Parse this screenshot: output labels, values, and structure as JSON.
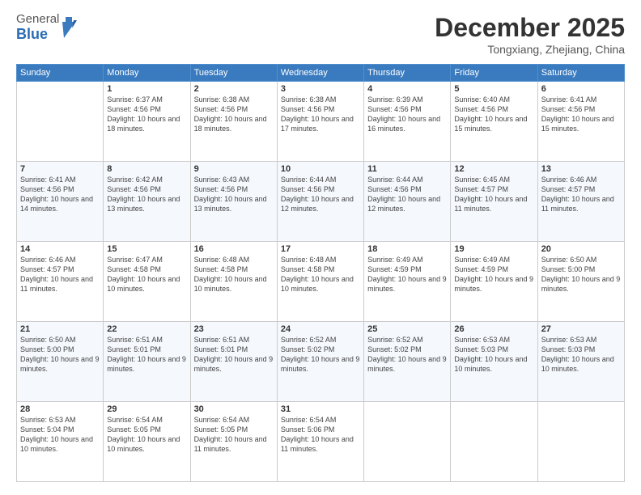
{
  "header": {
    "logo_general": "General",
    "logo_blue": "Blue",
    "month_year": "December 2025",
    "location": "Tongxiang, Zhejiang, China"
  },
  "weekdays": [
    "Sunday",
    "Monday",
    "Tuesday",
    "Wednesday",
    "Thursday",
    "Friday",
    "Saturday"
  ],
  "weeks": [
    [
      {
        "day": "",
        "sunrise": "",
        "sunset": "",
        "daylight": ""
      },
      {
        "day": "1",
        "sunrise": "Sunrise: 6:37 AM",
        "sunset": "Sunset: 4:56 PM",
        "daylight": "Daylight: 10 hours and 18 minutes."
      },
      {
        "day": "2",
        "sunrise": "Sunrise: 6:38 AM",
        "sunset": "Sunset: 4:56 PM",
        "daylight": "Daylight: 10 hours and 18 minutes."
      },
      {
        "day": "3",
        "sunrise": "Sunrise: 6:38 AM",
        "sunset": "Sunset: 4:56 PM",
        "daylight": "Daylight: 10 hours and 17 minutes."
      },
      {
        "day": "4",
        "sunrise": "Sunrise: 6:39 AM",
        "sunset": "Sunset: 4:56 PM",
        "daylight": "Daylight: 10 hours and 16 minutes."
      },
      {
        "day": "5",
        "sunrise": "Sunrise: 6:40 AM",
        "sunset": "Sunset: 4:56 PM",
        "daylight": "Daylight: 10 hours and 15 minutes."
      },
      {
        "day": "6",
        "sunrise": "Sunrise: 6:41 AM",
        "sunset": "Sunset: 4:56 PM",
        "daylight": "Daylight: 10 hours and 15 minutes."
      }
    ],
    [
      {
        "day": "7",
        "sunrise": "Sunrise: 6:41 AM",
        "sunset": "Sunset: 4:56 PM",
        "daylight": "Daylight: 10 hours and 14 minutes."
      },
      {
        "day": "8",
        "sunrise": "Sunrise: 6:42 AM",
        "sunset": "Sunset: 4:56 PM",
        "daylight": "Daylight: 10 hours and 13 minutes."
      },
      {
        "day": "9",
        "sunrise": "Sunrise: 6:43 AM",
        "sunset": "Sunset: 4:56 PM",
        "daylight": "Daylight: 10 hours and 13 minutes."
      },
      {
        "day": "10",
        "sunrise": "Sunrise: 6:44 AM",
        "sunset": "Sunset: 4:56 PM",
        "daylight": "Daylight: 10 hours and 12 minutes."
      },
      {
        "day": "11",
        "sunrise": "Sunrise: 6:44 AM",
        "sunset": "Sunset: 4:56 PM",
        "daylight": "Daylight: 10 hours and 12 minutes."
      },
      {
        "day": "12",
        "sunrise": "Sunrise: 6:45 AM",
        "sunset": "Sunset: 4:57 PM",
        "daylight": "Daylight: 10 hours and 11 minutes."
      },
      {
        "day": "13",
        "sunrise": "Sunrise: 6:46 AM",
        "sunset": "Sunset: 4:57 PM",
        "daylight": "Daylight: 10 hours and 11 minutes."
      }
    ],
    [
      {
        "day": "14",
        "sunrise": "Sunrise: 6:46 AM",
        "sunset": "Sunset: 4:57 PM",
        "daylight": "Daylight: 10 hours and 11 minutes."
      },
      {
        "day": "15",
        "sunrise": "Sunrise: 6:47 AM",
        "sunset": "Sunset: 4:58 PM",
        "daylight": "Daylight: 10 hours and 10 minutes."
      },
      {
        "day": "16",
        "sunrise": "Sunrise: 6:48 AM",
        "sunset": "Sunset: 4:58 PM",
        "daylight": "Daylight: 10 hours and 10 minutes."
      },
      {
        "day": "17",
        "sunrise": "Sunrise: 6:48 AM",
        "sunset": "Sunset: 4:58 PM",
        "daylight": "Daylight: 10 hours and 10 minutes."
      },
      {
        "day": "18",
        "sunrise": "Sunrise: 6:49 AM",
        "sunset": "Sunset: 4:59 PM",
        "daylight": "Daylight: 10 hours and 9 minutes."
      },
      {
        "day": "19",
        "sunrise": "Sunrise: 6:49 AM",
        "sunset": "Sunset: 4:59 PM",
        "daylight": "Daylight: 10 hours and 9 minutes."
      },
      {
        "day": "20",
        "sunrise": "Sunrise: 6:50 AM",
        "sunset": "Sunset: 5:00 PM",
        "daylight": "Daylight: 10 hours and 9 minutes."
      }
    ],
    [
      {
        "day": "21",
        "sunrise": "Sunrise: 6:50 AM",
        "sunset": "Sunset: 5:00 PM",
        "daylight": "Daylight: 10 hours and 9 minutes."
      },
      {
        "day": "22",
        "sunrise": "Sunrise: 6:51 AM",
        "sunset": "Sunset: 5:01 PM",
        "daylight": "Daylight: 10 hours and 9 minutes."
      },
      {
        "day": "23",
        "sunrise": "Sunrise: 6:51 AM",
        "sunset": "Sunset: 5:01 PM",
        "daylight": "Daylight: 10 hours and 9 minutes."
      },
      {
        "day": "24",
        "sunrise": "Sunrise: 6:52 AM",
        "sunset": "Sunset: 5:02 PM",
        "daylight": "Daylight: 10 hours and 9 minutes."
      },
      {
        "day": "25",
        "sunrise": "Sunrise: 6:52 AM",
        "sunset": "Sunset: 5:02 PM",
        "daylight": "Daylight: 10 hours and 9 minutes."
      },
      {
        "day": "26",
        "sunrise": "Sunrise: 6:53 AM",
        "sunset": "Sunset: 5:03 PM",
        "daylight": "Daylight: 10 hours and 10 minutes."
      },
      {
        "day": "27",
        "sunrise": "Sunrise: 6:53 AM",
        "sunset": "Sunset: 5:03 PM",
        "daylight": "Daylight: 10 hours and 10 minutes."
      }
    ],
    [
      {
        "day": "28",
        "sunrise": "Sunrise: 6:53 AM",
        "sunset": "Sunset: 5:04 PM",
        "daylight": "Daylight: 10 hours and 10 minutes."
      },
      {
        "day": "29",
        "sunrise": "Sunrise: 6:54 AM",
        "sunset": "Sunset: 5:05 PM",
        "daylight": "Daylight: 10 hours and 10 minutes."
      },
      {
        "day": "30",
        "sunrise": "Sunrise: 6:54 AM",
        "sunset": "Sunset: 5:05 PM",
        "daylight": "Daylight: 10 hours and 11 minutes."
      },
      {
        "day": "31",
        "sunrise": "Sunrise: 6:54 AM",
        "sunset": "Sunset: 5:06 PM",
        "daylight": "Daylight: 10 hours and 11 minutes."
      },
      {
        "day": "",
        "sunrise": "",
        "sunset": "",
        "daylight": ""
      },
      {
        "day": "",
        "sunrise": "",
        "sunset": "",
        "daylight": ""
      },
      {
        "day": "",
        "sunrise": "",
        "sunset": "",
        "daylight": ""
      }
    ]
  ]
}
